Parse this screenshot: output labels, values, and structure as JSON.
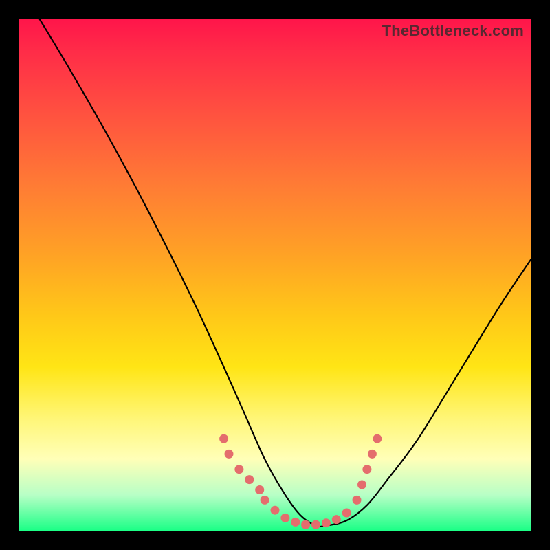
{
  "watermark": "TheBottleneck.com",
  "chart_data": {
    "type": "line",
    "title": "",
    "xlabel": "",
    "ylabel": "",
    "xlim": [
      0,
      100
    ],
    "ylim": [
      0,
      100
    ],
    "grid": false,
    "legend": false,
    "series": [
      {
        "name": "bottleneck-curve",
        "x": [
          4,
          10,
          18,
          26,
          34,
          40,
          44,
          48,
          52,
          55,
          58,
          60,
          64,
          68,
          72,
          78,
          86,
          94,
          100
        ],
        "y": [
          100,
          90,
          76,
          61,
          45,
          32,
          23,
          14,
          7,
          3,
          1,
          1,
          2,
          5,
          10,
          18,
          31,
          44,
          53
        ]
      }
    ],
    "markers": [
      {
        "x": 40,
        "y": 18
      },
      {
        "x": 41,
        "y": 15
      },
      {
        "x": 43,
        "y": 12
      },
      {
        "x": 45,
        "y": 10
      },
      {
        "x": 47,
        "y": 8
      },
      {
        "x": 48,
        "y": 6
      },
      {
        "x": 50,
        "y": 4
      },
      {
        "x": 52,
        "y": 2.5
      },
      {
        "x": 54,
        "y": 1.7
      },
      {
        "x": 56,
        "y": 1.2
      },
      {
        "x": 58,
        "y": 1.2
      },
      {
        "x": 60,
        "y": 1.5
      },
      {
        "x": 62,
        "y": 2.2
      },
      {
        "x": 64,
        "y": 3.5
      },
      {
        "x": 66,
        "y": 6
      },
      {
        "x": 67,
        "y": 9
      },
      {
        "x": 68,
        "y": 12
      },
      {
        "x": 69,
        "y": 15
      },
      {
        "x": 70,
        "y": 18
      }
    ]
  }
}
